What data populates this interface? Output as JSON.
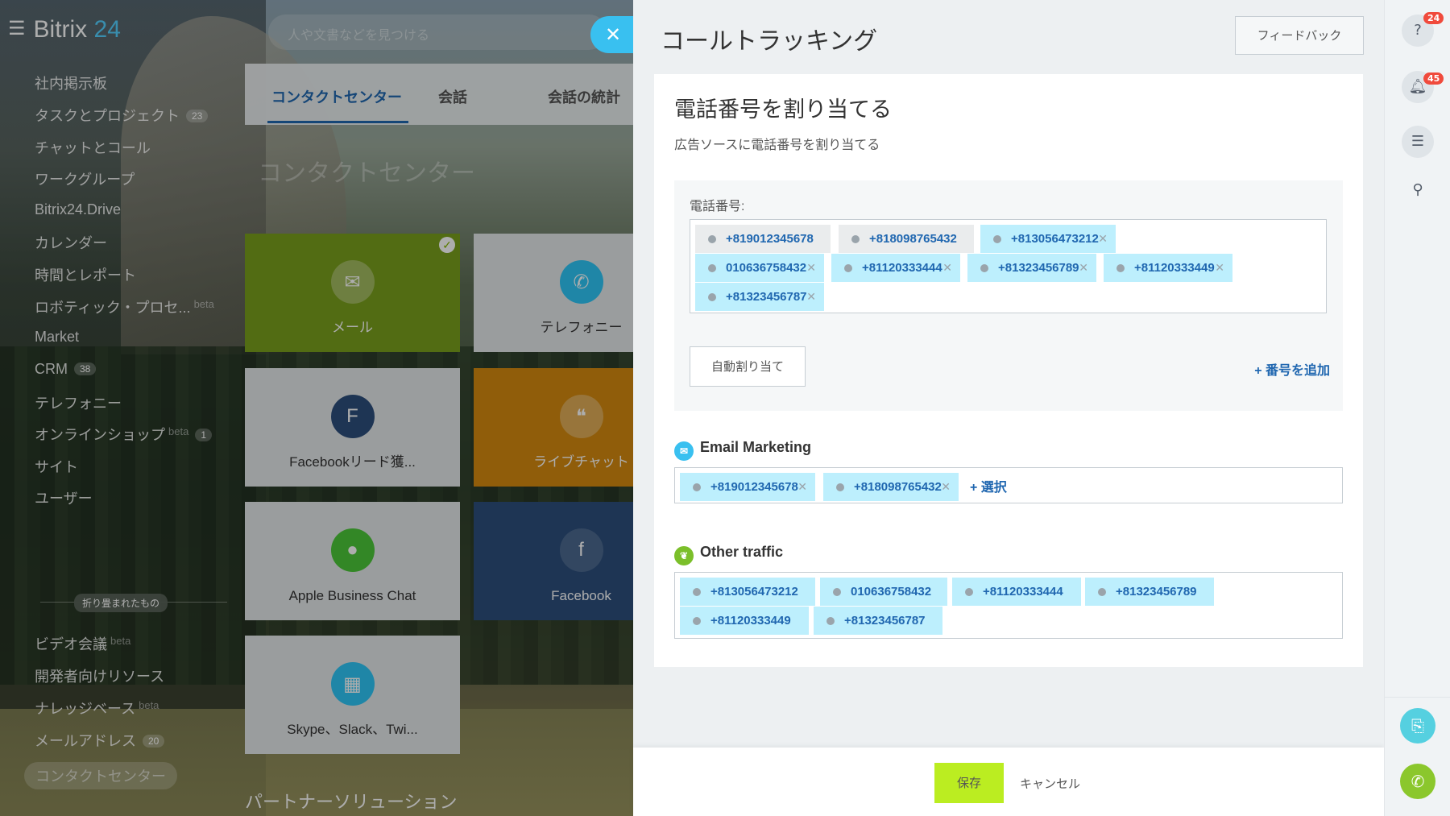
{
  "app": {
    "logo_text": "Bitrix",
    "logo_num": "24"
  },
  "search": {
    "placeholder": "人や文書などを見つける"
  },
  "menu": {
    "items": [
      {
        "label": "社内掲示板"
      },
      {
        "label": "タスクとプロジェクト",
        "counter": "23"
      },
      {
        "label": "チャットとコール"
      },
      {
        "label": "ワークグループ"
      },
      {
        "label": "Bitrix24.Drive"
      },
      {
        "label": "カレンダー"
      },
      {
        "label": "時間とレポート"
      },
      {
        "label": "ロボティック・プロセ...",
        "beta": "beta"
      },
      {
        "label": "Market"
      },
      {
        "label": "CRM",
        "counter": "38"
      },
      {
        "label": "テレフォニー"
      },
      {
        "label": "オンラインショップ",
        "beta": "beta",
        "counter": "1"
      },
      {
        "label": "サイト"
      },
      {
        "label": "ユーザー"
      }
    ],
    "collapsed_label": "折り畳まれたもの",
    "collapsed_items": [
      {
        "label": "ビデオ会議",
        "beta": "beta"
      },
      {
        "label": "開発者向けリソース"
      },
      {
        "label": "ナレッジベース",
        "beta": "beta"
      },
      {
        "label": "メールアドレス",
        "counter": "20"
      },
      {
        "label": "コンタクトセンター"
      }
    ]
  },
  "contact_center": {
    "tabs": [
      "コンタクトセンター",
      "会話",
      "会話の統計"
    ],
    "heading": "コンタクトセンター",
    "tiles": [
      {
        "label": "メール",
        "icon": "envelope-icon",
        "color": "#7aa01c"
      },
      {
        "label": "テレフォニー",
        "icon": "phone-icon",
        "color": "#e4e7e9"
      },
      {
        "label": "Facebookリード獲...",
        "icon": "facebook-leads-icon",
        "color": "#e4e7e9"
      },
      {
        "label": "ライブチャット",
        "icon": "chat-icon",
        "color": "#d48a10"
      },
      {
        "label": "Apple Business Chat",
        "icon": "apple-chat-icon",
        "color": "#e4e7e9"
      },
      {
        "label": "Facebook",
        "icon": "facebook-icon",
        "color": "#2d4f7c"
      },
      {
        "label": "Skype、Slack、Twi...",
        "icon": "apps-grid-icon",
        "color": "#e4e7e9"
      }
    ],
    "partner_heading": "パートナーソリューション"
  },
  "panel": {
    "title": "コールトラッキング",
    "feedback_label": "フィードバック",
    "card_title": "電話番号を割り当てる",
    "card_subtitle": "広告ソースに電話番号を割り当てる",
    "phones_label": "電話番号:",
    "phones": [
      {
        "number": "+819012345678",
        "state": "used",
        "removable": false
      },
      {
        "number": "+818098765432",
        "state": "used",
        "removable": false
      },
      {
        "number": "+813056473212",
        "state": "free",
        "removable": true
      },
      {
        "number": "010636758432",
        "state": "free",
        "removable": true
      },
      {
        "number": "+81120333444",
        "state": "free",
        "removable": true
      },
      {
        "number": "+81323456789",
        "state": "free",
        "removable": true
      },
      {
        "number": "+81120333449",
        "state": "free",
        "removable": true
      },
      {
        "number": "+81323456787",
        "state": "free",
        "removable": true
      }
    ],
    "auto_assign_label": "自動割り当て",
    "add_number_label": "+ 番号を追加",
    "sources": [
      {
        "title": "Email Marketing",
        "icon": "email-marketing-icon",
        "icon_color": "#39c0f0",
        "numbers": [
          "+819012345678",
          "+818098765432"
        ],
        "removable": true,
        "select_label": "+ 選択"
      },
      {
        "title": "Other traffic",
        "icon": "leaf-icon",
        "icon_color": "#7bbf2a",
        "numbers": [
          "+813056473212",
          "010636758432",
          "+81120333444",
          "+81323456789",
          "+81120333449",
          "+81323456787"
        ],
        "removable": false
      }
    ],
    "save_label": "保存",
    "cancel_label": "キャンセル"
  },
  "rightbar": {
    "help_badge": "24",
    "notifications_badge": "45"
  },
  "colors": {
    "accent_blue": "#2067b0",
    "tag_blue": "#bdeffd",
    "save_green": "#bbed21",
    "close_cyan": "#39c0f0"
  }
}
